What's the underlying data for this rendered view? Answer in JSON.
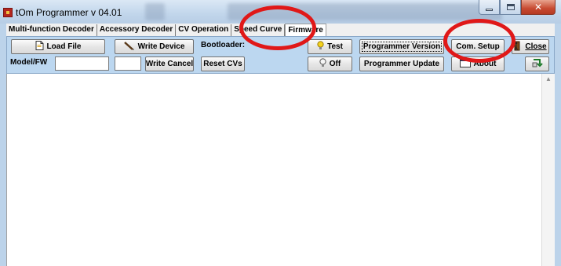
{
  "window": {
    "title": "tOm Programmer v 04.01"
  },
  "tabs": [
    {
      "label": "Multi-function Decoder",
      "active": false
    },
    {
      "label": "Accessory Decoder",
      "active": false
    },
    {
      "label": "CV Operation",
      "active": false
    },
    {
      "label": "Speed Curve",
      "active": false
    },
    {
      "label": "Firmware",
      "active": true
    }
  ],
  "toolbar": {
    "load_file": "Load File",
    "write_device": "Write Device",
    "model_fw_label": "Model/FW",
    "model_fw_value": "",
    "model_fw_value2": "",
    "write_cancel": "Write Cancel",
    "bootloader_label": "Bootloader:",
    "reset_cvs": "Reset CVs",
    "test": "Test",
    "off": "Off",
    "programmer_version": "Programmer Version",
    "programmer_update": "Programmer Update",
    "com_setup": "Com. Setup",
    "about": "About",
    "close": "Close"
  },
  "icons": {
    "app": "app-icon",
    "load_file": "document-icon",
    "write_device": "pencil-icon",
    "test": "lightbulb-on-icon",
    "off": "lightbulb-off-icon",
    "about": "info-icon",
    "close": "door-exit-icon",
    "extra": "swap-icon"
  },
  "colors": {
    "toolbar_bg": "#bcd7f0",
    "annotation_circle": "#e01818"
  }
}
